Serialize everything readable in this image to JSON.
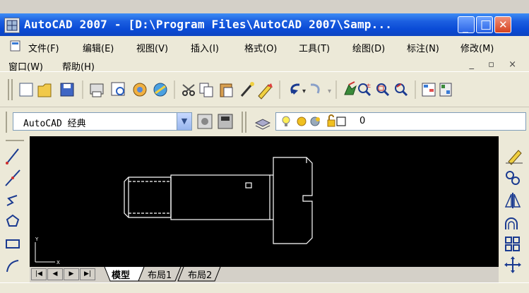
{
  "window": {
    "title": "AutoCAD 2007 - [D:\\Program Files\\AutoCAD 2007\\Samp...",
    "controls": {
      "minimize": "_",
      "maximize": "□",
      "close": "✕"
    }
  },
  "menu": {
    "row1": [
      "文件(F)",
      "编辑(E)",
      "视图(V)",
      "插入(I)",
      "格式(O)",
      "工具(T)",
      "绘图(D)",
      "标注(N)",
      "修改(M)"
    ],
    "row2": [
      "窗口(W)",
      "帮助(H)"
    ],
    "mdi_controls": "_ ▫ ×"
  },
  "workspace": {
    "selected": "AutoCAD 经典"
  },
  "layer": {
    "name": "0"
  },
  "layout_tabs": [
    "模型",
    "布局1",
    "布局2"
  ],
  "colors": {
    "title_bar": "#0a4bd6",
    "canvas": "#000000",
    "drawing_lines": "#ffffff"
  }
}
